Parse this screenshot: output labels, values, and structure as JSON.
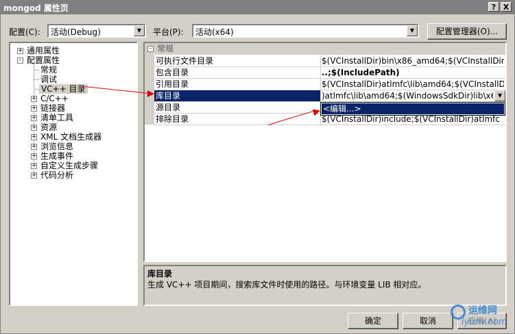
{
  "window": {
    "title": "mongod 属性页",
    "help_btn": "?",
    "close_btn": "X"
  },
  "toolbar": {
    "config_label": "配置(C):",
    "config_value": "活动(Debug)",
    "platform_label": "平台(P):",
    "platform_value": "活动(x64)",
    "config_manager_btn": "配置管理器(O)..."
  },
  "tree": {
    "items": [
      {
        "label": "通用属性",
        "expander": "+"
      },
      {
        "label": "配置属性",
        "expander": "-"
      },
      {
        "label": "常规"
      },
      {
        "label": "调试"
      },
      {
        "label": "VC++ 目录"
      },
      {
        "label": "C/C++",
        "expander": "+"
      },
      {
        "label": "链接器",
        "expander": "+"
      },
      {
        "label": "清单工具",
        "expander": "+"
      },
      {
        "label": "资源",
        "expander": "+"
      },
      {
        "label": "XML 文档生成器",
        "expander": "+"
      },
      {
        "label": "浏览信息",
        "expander": "+"
      },
      {
        "label": "生成事件",
        "expander": "+"
      },
      {
        "label": "自定义生成步骤",
        "expander": "+"
      },
      {
        "label": "代码分析",
        "expander": "+"
      }
    ]
  },
  "grid": {
    "category": "常规",
    "category_expander": "-",
    "rows": [
      {
        "name": "可执行文件目录",
        "value": "$(VCInstallDir)bin\\x86_amd64;$(VCInstallDir)b"
      },
      {
        "name": "包含目录",
        "value": "..;$(IncludePath)"
      },
      {
        "name": "引用目录",
        "value": "$(VCInstallDir)atlmfc\\lib\\amd64;$(VCInstallDi"
      },
      {
        "name": "库目录",
        "value": ")atlmfc\\lib\\amd64;$(WindowsSdkDir)lib\\x64;"
      },
      {
        "name": "源目录",
        "value": ""
      },
      {
        "name": "排除目录",
        "value": "$(VCInstallDir)include;$(VCInstallDir)atlmfc"
      }
    ],
    "dropdown_item": "<编辑...>"
  },
  "description": {
    "title": "库目录",
    "text": "生成 VC++ 项目期间，搜索库文件时使用的路径。与环境变量 LIB 相对应。"
  },
  "footer": {
    "ok": "确定",
    "cancel": "取消",
    "apply": "应用(A)"
  },
  "watermark": {
    "text1": "运维网",
    "text2": "iyunv.com"
  },
  "colors": {
    "selection": "#0a246a",
    "annotation_arrow": "#e00000"
  }
}
